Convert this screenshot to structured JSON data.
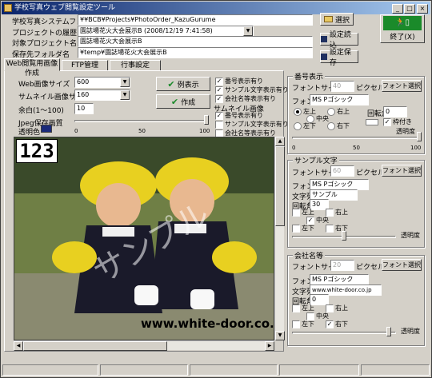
{
  "window": {
    "title": "学校写真ウェブ閲覧設定ツール",
    "close_glyph": "×"
  },
  "settings": {
    "system_folder_label": "学校写真システムフォルダ",
    "system_folder_value": "¥¥BCB¥Projects¥PhotoOrder_KazuGurume",
    "history_label": "プロジェクトの履歴",
    "history_value": "園誌場花火大会展示B (2008/12/19 7:41:58)",
    "target_label": "対象プロジェクト名",
    "target_value": "園誌場花火大会展示B",
    "save_folder_label": "保存先フォルダ名",
    "save_folder_value": "¥temp¥園誌場花火大会展示B"
  },
  "buttons": {
    "select": "選択",
    "load_settings": "設定読込",
    "save_settings": "設定保存",
    "exit": "終了(X)",
    "preview": "例表示",
    "create": "作成"
  },
  "tabs": [
    "Web閲覧用画像作成",
    "FTP管理",
    "行事設定"
  ],
  "web": {
    "web_size_label": "Web画像サイズ",
    "web_size_value": "600",
    "thumb_size_label": "サムネイル画像サイズ",
    "thumb_size_value": "160",
    "margin_label": "余白(1～100)",
    "margin_value": "10",
    "jpeg_label": "Jpeg保存画質",
    "transparent_label": "透明色",
    "transparent_color": "#1a2a7a",
    "jpeg_ticks": [
      "0",
      "50",
      "100"
    ],
    "jpeg_quality": 100,
    "main_checks": [
      {
        "label": "番号表示有り",
        "checked": true
      },
      {
        "label": "サンプル文字表示有り",
        "checked": true
      },
      {
        "label": "会社名等表示有り",
        "checked": true
      }
    ],
    "thumb_title": "サムネイル画像",
    "thumb_checks": [
      {
        "label": "番号表示有り",
        "checked": true
      },
      {
        "label": "サンプル文字表示有り",
        "checked": false
      },
      {
        "label": "会社名等表示有り",
        "checked": false
      }
    ]
  },
  "preview": {
    "number": "123",
    "watermark": "サンプル",
    "website": "www.white-door.co.jp"
  },
  "number_panel": {
    "title": "番号表示",
    "font_size_label": "フォントサイズ",
    "font_size_value": "40",
    "pixel_label": "ピクセル",
    "font_select": "フォント選択",
    "font_label": "フォント",
    "font_value": "MS Pゴシック",
    "positions": [
      "左上",
      "右上",
      "中央",
      "左下",
      "右下"
    ],
    "rotation_label": "回転角",
    "rotation_value": "0",
    "frame_label": "枠付き",
    "opacity_label": "透明度",
    "ticks": [
      "0",
      "50",
      "100"
    ]
  },
  "sample_panel": {
    "title": "サンプル文字",
    "font_size_label": "フォントサイズ",
    "font_size_value": "60",
    "pixel_label": "ピクセル",
    "font_select": "フォント選択",
    "font_label": "フォント",
    "font_value": "MS Pゴシック",
    "text_label": "文字列",
    "text_value": "サンプル",
    "rotation_label": "回転角",
    "rotation_value": "30",
    "positions": [
      "左上",
      "右上",
      "中央",
      "左下",
      "右下"
    ],
    "opacity_label": "透明度"
  },
  "company_panel": {
    "title": "会社名等",
    "font_size_label": "フォントサイズ",
    "font_size_value": "20",
    "pixel_label": "ピクセル",
    "font_select": "フォント選択",
    "font_label": "フォント",
    "font_value": "MS Pゴシック",
    "text_label": "文字列",
    "text_value": "www.white-door.co.jp",
    "rotation_label": "回転角",
    "rotation_value": "0",
    "positions": [
      "左上",
      "右上",
      "中央",
      "左下",
      "右下"
    ],
    "opacity_label": "透明度"
  },
  "colors": {
    "accent_green": "#1a8a2a",
    "title_blue": "#0a246a"
  }
}
